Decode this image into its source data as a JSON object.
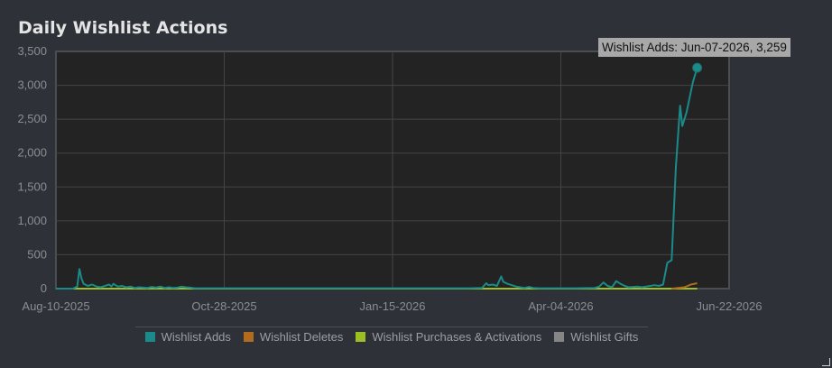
{
  "chart_data": {
    "type": "line",
    "title": "Daily Wishlist Actions",
    "xlabel": "",
    "ylabel": "",
    "x_ticks": [
      "Aug-10-2025",
      "Oct-28-2025",
      "Jan-15-2026",
      "Apr-04-2026",
      "Jun-22-2026"
    ],
    "y_ticks": [
      "0",
      "500",
      "1,000",
      "1,500",
      "2,000",
      "2,500",
      "3,000",
      "3,500"
    ],
    "xlim": [
      "2025-08-10",
      "2026-06-22"
    ],
    "ylim": [
      0,
      3500
    ],
    "grid": true,
    "legend_position": "bottom",
    "series": [
      {
        "name": "Wishlist Adds",
        "color": "#1a8b8a",
        "points": [
          [
            "2025-08-10",
            0
          ],
          [
            "2025-08-18",
            0
          ],
          [
            "2025-08-20",
            30
          ],
          [
            "2025-08-21",
            290
          ],
          [
            "2025-08-22",
            150
          ],
          [
            "2025-08-23",
            70
          ],
          [
            "2025-08-25",
            40
          ],
          [
            "2025-08-27",
            60
          ],
          [
            "2025-08-29",
            30
          ],
          [
            "2025-08-31",
            20
          ],
          [
            "2025-09-02",
            40
          ],
          [
            "2025-09-04",
            60
          ],
          [
            "2025-09-05",
            30
          ],
          [
            "2025-09-06",
            70
          ],
          [
            "2025-09-08",
            30
          ],
          [
            "2025-09-10",
            40
          ],
          [
            "2025-09-12",
            20
          ],
          [
            "2025-09-14",
            30
          ],
          [
            "2025-09-16",
            10
          ],
          [
            "2025-09-18",
            20
          ],
          [
            "2025-09-20",
            15
          ],
          [
            "2025-09-22",
            10
          ],
          [
            "2025-09-24",
            25
          ],
          [
            "2025-09-26",
            15
          ],
          [
            "2025-09-28",
            30
          ],
          [
            "2025-09-30",
            10
          ],
          [
            "2025-10-02",
            20
          ],
          [
            "2025-10-04",
            10
          ],
          [
            "2025-10-06",
            15
          ],
          [
            "2025-10-08",
            30
          ],
          [
            "2025-10-10",
            20
          ],
          [
            "2025-10-12",
            15
          ],
          [
            "2025-10-14",
            5
          ],
          [
            "2025-10-20",
            5
          ],
          [
            "2025-11-15",
            5
          ],
          [
            "2025-12-20",
            5
          ],
          [
            "2026-01-20",
            5
          ],
          [
            "2026-02-20",
            5
          ],
          [
            "2026-02-26",
            10
          ],
          [
            "2026-02-28",
            80
          ],
          [
            "2026-03-01",
            50
          ],
          [
            "2026-03-03",
            60
          ],
          [
            "2026-03-05",
            40
          ],
          [
            "2026-03-07",
            180
          ],
          [
            "2026-03-08",
            100
          ],
          [
            "2026-03-10",
            70
          ],
          [
            "2026-03-12",
            50
          ],
          [
            "2026-03-14",
            30
          ],
          [
            "2026-03-16",
            20
          ],
          [
            "2026-03-18",
            10
          ],
          [
            "2026-03-20",
            25
          ],
          [
            "2026-03-22",
            10
          ],
          [
            "2026-03-25",
            5
          ],
          [
            "2026-04-10",
            5
          ],
          [
            "2026-04-20",
            10
          ],
          [
            "2026-04-22",
            30
          ],
          [
            "2026-04-24",
            90
          ],
          [
            "2026-04-26",
            40
          ],
          [
            "2026-04-28",
            20
          ],
          [
            "2026-04-30",
            110
          ],
          [
            "2026-05-02",
            70
          ],
          [
            "2026-05-04",
            40
          ],
          [
            "2026-05-06",
            20
          ],
          [
            "2026-05-08",
            25
          ],
          [
            "2026-05-10",
            30
          ],
          [
            "2026-05-12",
            20
          ],
          [
            "2026-05-14",
            30
          ],
          [
            "2026-05-16",
            40
          ],
          [
            "2026-05-18",
            50
          ],
          [
            "2026-05-20",
            40
          ],
          [
            "2026-05-22",
            60
          ],
          [
            "2026-05-24",
            380
          ],
          [
            "2026-05-26",
            420
          ],
          [
            "2026-05-28",
            1800
          ],
          [
            "2026-05-30",
            2700
          ],
          [
            "2026-05-31",
            2400
          ],
          [
            "2026-06-02",
            2600
          ],
          [
            "2026-06-05",
            3050
          ],
          [
            "2026-06-07",
            3259
          ]
        ]
      },
      {
        "name": "Wishlist Deletes",
        "color": "#b06c1e",
        "points": [
          [
            "2026-05-26",
            0
          ],
          [
            "2026-06-01",
            20
          ],
          [
            "2026-06-04",
            60
          ],
          [
            "2026-06-07",
            80
          ]
        ]
      },
      {
        "name": "Wishlist Purchases & Activations",
        "color": "#9cbf25",
        "points": [
          [
            "2025-08-10",
            0
          ],
          [
            "2026-06-07",
            0
          ]
        ]
      },
      {
        "name": "Wishlist Gifts",
        "color": "#858585",
        "points": [
          [
            "2025-08-10",
            0
          ],
          [
            "2026-06-07",
            0
          ]
        ]
      }
    ],
    "highlight": {
      "series": "Wishlist Adds",
      "x": "2026-06-07",
      "y": 3259
    }
  },
  "tooltip": {
    "text": "Wishlist Adds: Jun-07-2026, 3,259"
  }
}
